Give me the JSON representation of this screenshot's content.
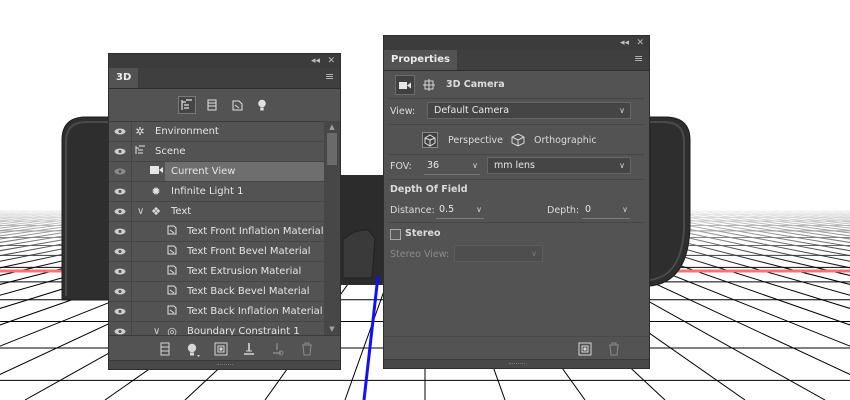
{
  "panel_3d": {
    "tab": "3D",
    "collapse": "◂◂",
    "close": "✕",
    "filters": [
      "whole-scene-filter-icon",
      "meshes-filter-icon",
      "materials-filter-icon",
      "lights-filter-icon"
    ],
    "layers": [
      {
        "label": "Environment",
        "icon": "environment-icon"
      },
      {
        "label": "Scene",
        "icon": "scene-icon"
      },
      {
        "label": "Current View",
        "icon": "camera-view-icon",
        "selected": true
      },
      {
        "label": "Infinite Light 1",
        "icon": "infinite-light-icon"
      },
      {
        "label": "Text",
        "icon": "text-mesh-icon",
        "expanded": true
      },
      {
        "label": "Text Front Inflation Material",
        "icon": "material-icon"
      },
      {
        "label": "Text Front Bevel Material",
        "icon": "material-icon"
      },
      {
        "label": "Text Extrusion Material",
        "icon": "material-icon"
      },
      {
        "label": "Text Back Bevel Material",
        "icon": "material-icon"
      },
      {
        "label": "Text Back Inflation Material",
        "icon": "material-icon"
      },
      {
        "label": "Boundary Constraint 1",
        "icon": "constraint-icon",
        "expanded": true
      }
    ],
    "bottom_icons": [
      "mesh-icon",
      "add-light-icon",
      "render-icon",
      "ground-icon",
      "constraint-plus-icon",
      "trash-icon"
    ]
  },
  "properties": {
    "tab": "Properties",
    "collapse": "◂◂",
    "close": "✕",
    "header": "3D Camera",
    "view_label": "View:",
    "view_value": "Default Camera",
    "perspective_label": "Perspective",
    "orthographic_label": "Orthographic",
    "fov_label": "FOV:",
    "fov_value": "36",
    "fov_unit": "mm lens",
    "dof_title": "Depth Of Field",
    "distance_label": "Distance:",
    "distance_value": "0.5",
    "depth_label": "Depth:",
    "depth_value": "0",
    "stereo_label": "Stereo",
    "stereo_view_label": "Stereo View:",
    "stereo_checked": false,
    "bottom_icons": [
      "render-icon",
      "trash-icon"
    ]
  },
  "colors": {
    "panel": "#535353",
    "ground_line": "#000000",
    "horizon_line": "#ff6a6a",
    "axis_line": "#1a1aff",
    "object": "#2f2f2f"
  }
}
